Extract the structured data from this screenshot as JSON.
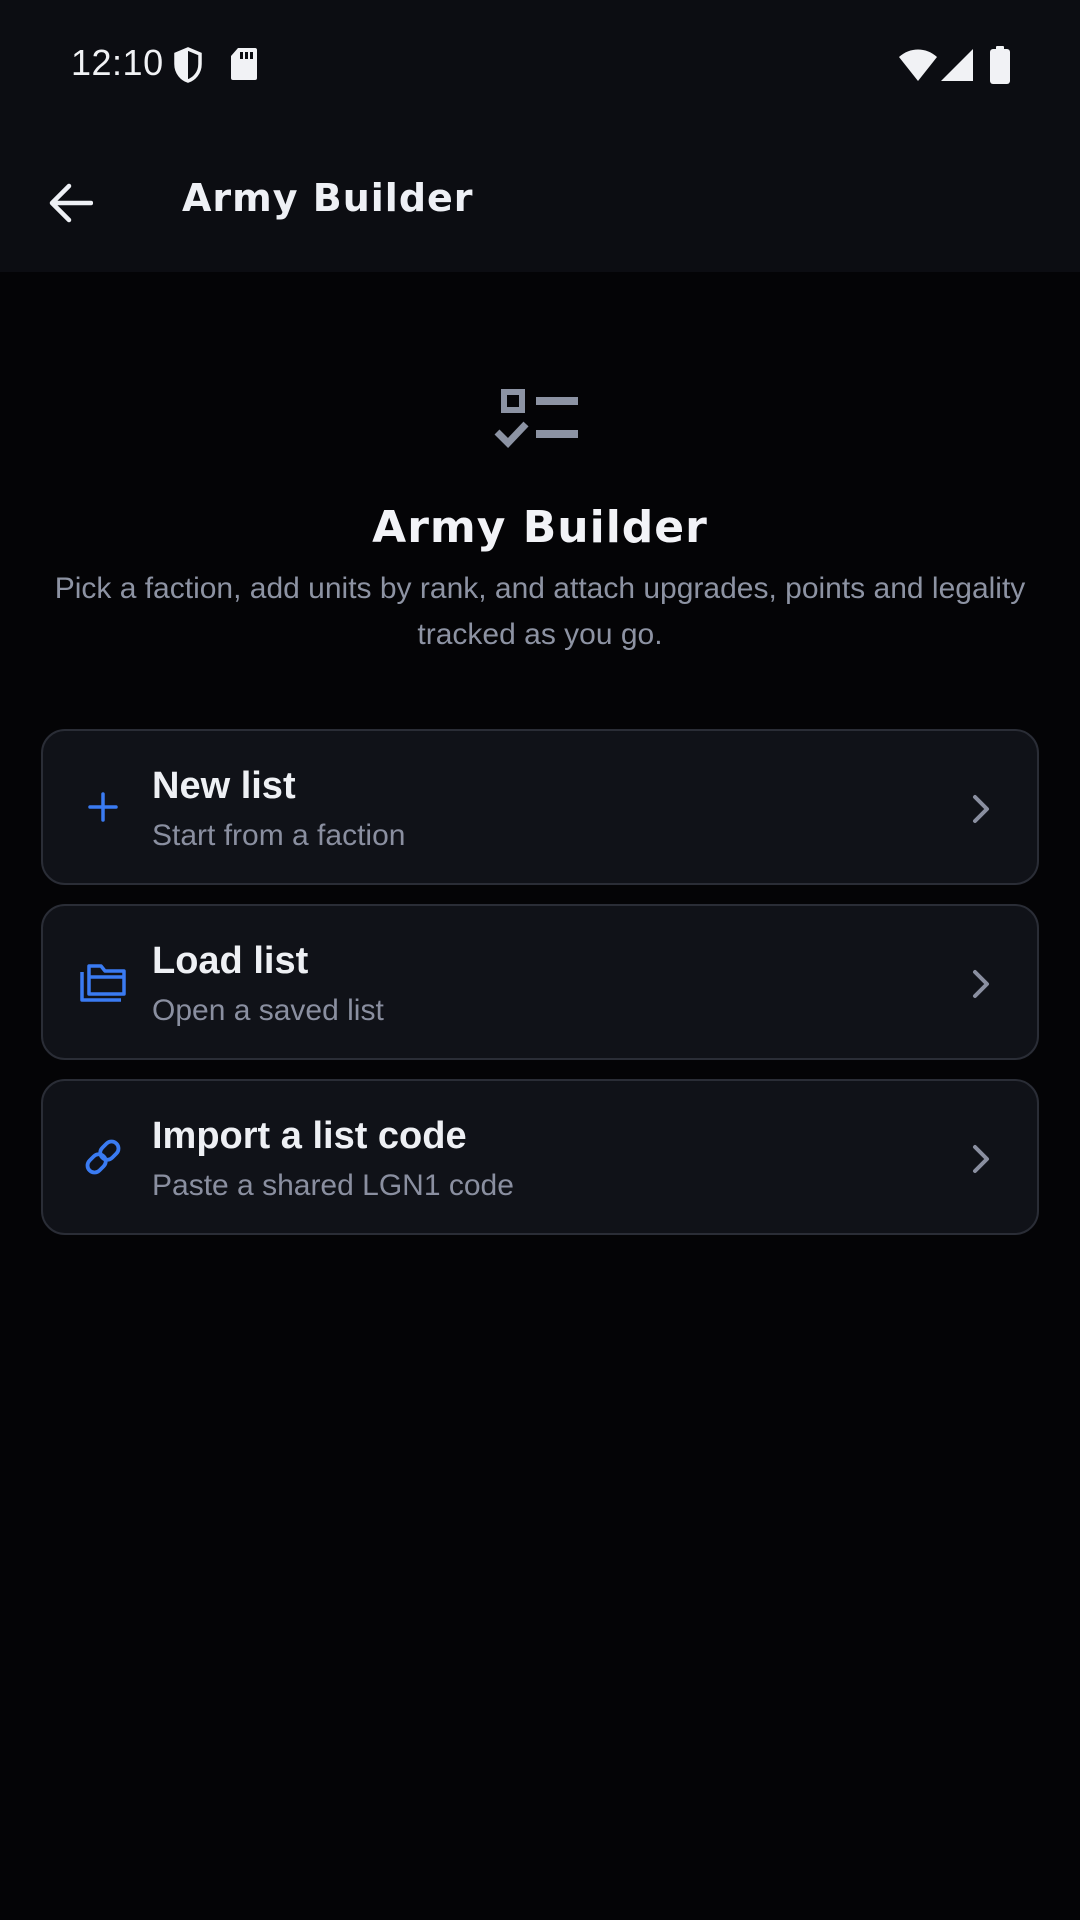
{
  "status_bar": {
    "time": "12:10",
    "icons": [
      "shield-icon",
      "sd-card-icon",
      "wifi-icon",
      "signal-icon",
      "battery-icon"
    ]
  },
  "app_bar": {
    "title": "Army Builder",
    "back_icon": "arrow-left-icon"
  },
  "hero": {
    "icon": "checklist-icon",
    "title": "Army Builder",
    "description": "Pick a faction, add units by rank, and attach upgrades, points and legality tracked as you go."
  },
  "actions": [
    {
      "icon": "plus-icon",
      "title": "New list",
      "subtitle": "Start from a faction"
    },
    {
      "icon": "folder-icon",
      "title": "Load list",
      "subtitle": "Open a saved list"
    },
    {
      "icon": "link-icon",
      "title": "Import a list code",
      "subtitle": "Paste a shared LGN1 code"
    }
  ],
  "colors": {
    "background": "#040406",
    "bar": "#0c0d12",
    "card": "#101218",
    "card_border": "#2a2d36",
    "accent": "#3a7bf2",
    "muted_text": "#8a8fa0"
  }
}
